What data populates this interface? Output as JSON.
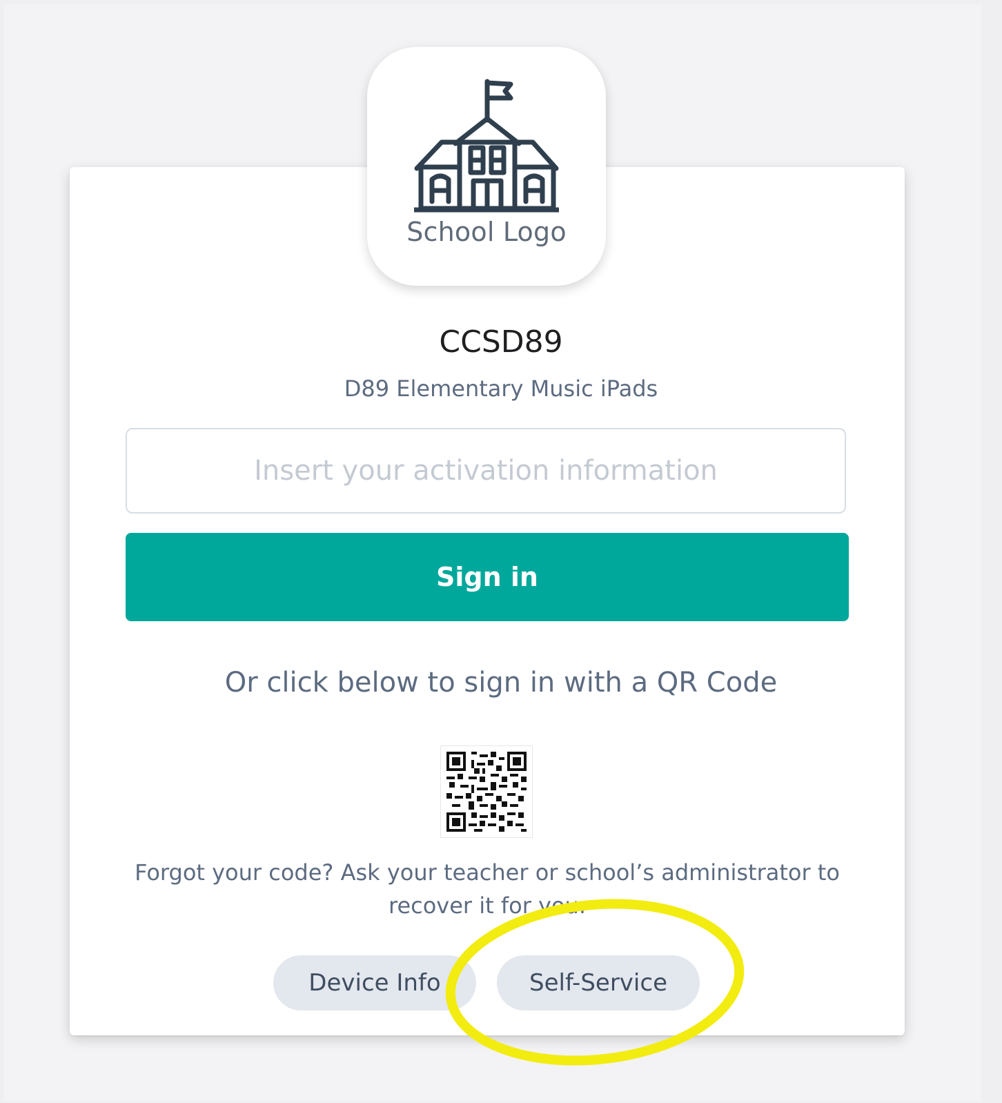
{
  "logo": {
    "icon": "schoolhouse-icon",
    "label": "School Logo"
  },
  "organization": {
    "name": "CCSD89",
    "subtitle": "D89 Elementary Music iPads"
  },
  "activation": {
    "placeholder": "Insert your activation information",
    "value": ""
  },
  "signin": {
    "label": "Sign in"
  },
  "qr": {
    "caption": "Or click below to sign in with a QR Code",
    "icon": "qr-code-icon"
  },
  "help": {
    "forgot_text": "Forgot your code? Ask your teacher or school’s administrator to recover it for you."
  },
  "footer_buttons": {
    "device_info": "Device Info",
    "self_service": "Self-Service"
  },
  "colors": {
    "accent": "#00a79b",
    "highlight": "#f2ec10",
    "pill_bg": "#e3e7ee",
    "muted_text": "#5c6b80"
  }
}
